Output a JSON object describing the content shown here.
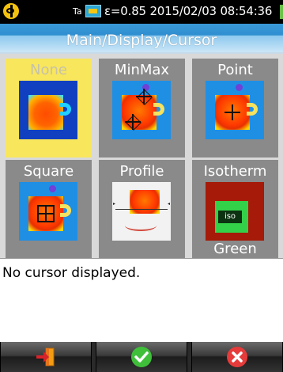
{
  "status": {
    "ta_label": "Ta",
    "text": "ε=0.85  2015/02/03 08:54:36",
    "icons": [
      "flir-logo-icon",
      "ambient-temp-icon",
      "battery-icon"
    ]
  },
  "header": {
    "title": "Main/Display/Cursor"
  },
  "tiles": [
    {
      "label": "None",
      "icon": "thermal-cup-icon"
    },
    {
      "label": "MinMax",
      "icon": "thermal-cup-minmax-icon"
    },
    {
      "label": "Point",
      "icon": "thermal-cup-point-icon"
    },
    {
      "label": "Square",
      "icon": "thermal-cup-square-icon"
    },
    {
      "label": "Profile",
      "icon": "thermal-cup-profile-icon"
    },
    {
      "label": "Isotherm",
      "sub": "Green",
      "icon": "thermal-cup-isotherm-icon",
      "iso_tag": "iso"
    }
  ],
  "selected_index": 0,
  "description": "No cursor displayed.",
  "footer": {
    "buttons": [
      {
        "icon": "exit-icon"
      },
      {
        "icon": "confirm-check-icon"
      },
      {
        "icon": "cancel-x-icon"
      }
    ]
  },
  "colors": {
    "selected_tile": "#f8e65c",
    "tile": "#8a8a8a",
    "title_bar": "#3a9ad8"
  }
}
